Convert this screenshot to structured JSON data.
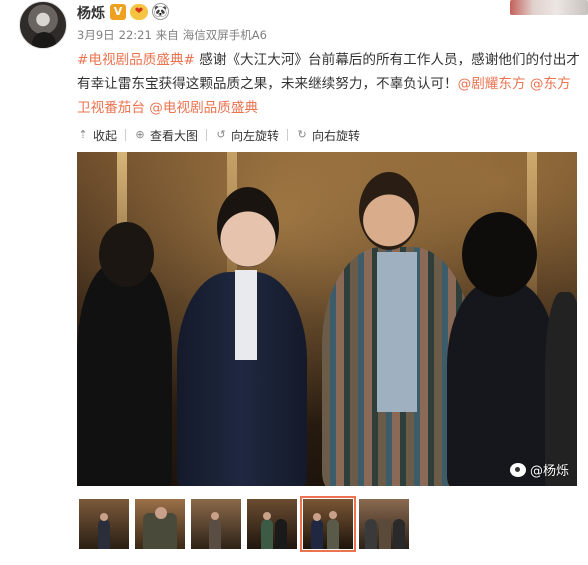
{
  "post": {
    "username": "杨烁",
    "verified_badge": "V",
    "vip_badge": "❤",
    "panda_badge": "🐼",
    "date": "3月9日",
    "time": "22:21",
    "source_prefix": "来自",
    "source_device": "海信双屏手机A6",
    "text": {
      "tag_start": "#电视剧品质盛典#",
      "body_1": " 感谢《大江大河》台前幕后的所有工作人员，感谢他们的付出才有幸让雷东宝获得这颗品质之果，未来继续努力，不辜负认可！",
      "mention_1": "@剧耀东方",
      "space_1": " ",
      "mention_2": "@东方卫视番茄台",
      "space_2": " ",
      "mention_3": "@电视剧品质盛典"
    }
  },
  "toolbar": {
    "collapse_label": "收起",
    "view_large_label": "查看大图",
    "rotate_left_label": "向左旋转",
    "rotate_right_label": "向右旋转"
  },
  "photo": {
    "watermark": "@杨烁"
  },
  "thumbnails": {
    "count": 6,
    "active_index": 4
  },
  "colors": {
    "link": "#eb7350",
    "text": "#333333",
    "meta": "#808080"
  }
}
